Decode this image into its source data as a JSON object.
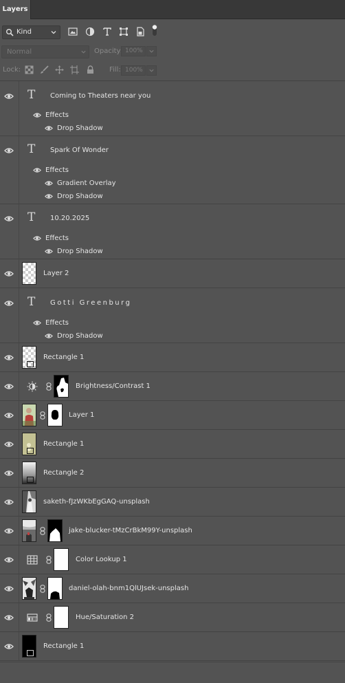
{
  "panel": {
    "tab_label": "Layers"
  },
  "filter": {
    "kind_label": "Kind",
    "icons": [
      "image-filter-icon",
      "adjustment-filter-icon",
      "type-filter-icon",
      "shape-filter-icon",
      "smart-object-filter-icon",
      "filter-toggle-icon"
    ]
  },
  "blend": {
    "mode": "Normal",
    "opacity_label": "Opacity:",
    "opacity_value": "100%",
    "lock_label": "Lock:",
    "fill_label": "Fill:",
    "fill_value": "100%"
  },
  "layers": [
    {
      "type": "text",
      "name": "Coming to Theaters near you",
      "effects_label": "Effects",
      "effects": [
        "Drop Shadow"
      ]
    },
    {
      "type": "text",
      "name": "Spark Of Wonder",
      "effects_label": "Effects",
      "effects": [
        "Gradient Overlay",
        "Drop Shadow"
      ]
    },
    {
      "type": "text",
      "name": "10.20.2025",
      "effects_label": "Effects",
      "effects": [
        "Drop Shadow"
      ]
    },
    {
      "type": "pixel",
      "name": "Layer 2"
    },
    {
      "type": "text",
      "name": "Gotti Greenburg",
      "effects_label": "Effects",
      "effects": [
        "Drop Shadow"
      ]
    },
    {
      "type": "shape",
      "name": "Rectangle 1"
    },
    {
      "type": "adjustment",
      "name": "Brightness/Contrast 1",
      "icon": "brightness-contrast-icon"
    },
    {
      "type": "masked",
      "name": "Layer 1"
    },
    {
      "type": "shape",
      "name": "Rectangle 1"
    },
    {
      "type": "shape",
      "name": "Rectangle 2"
    },
    {
      "type": "pixel",
      "name": "saketh-fJzWKbEgGAQ-unsplash"
    },
    {
      "type": "masked",
      "name": "jake-blucker-tMzCrBkM99Y-unsplash"
    },
    {
      "type": "adjustment",
      "name": "Color Lookup 1",
      "icon": "color-lookup-icon"
    },
    {
      "type": "masked",
      "name": "daniel-olah-bnm1QlUJsek-unsplash"
    },
    {
      "type": "adjustment",
      "name": "Hue/Saturation 2",
      "icon": "hue-saturation-icon"
    },
    {
      "type": "shape",
      "name": "Rectangle 1"
    }
  ],
  "colors": {
    "panel_bg": "#535353",
    "tabbar_bg": "#383838",
    "text": "#e6e6e6"
  }
}
